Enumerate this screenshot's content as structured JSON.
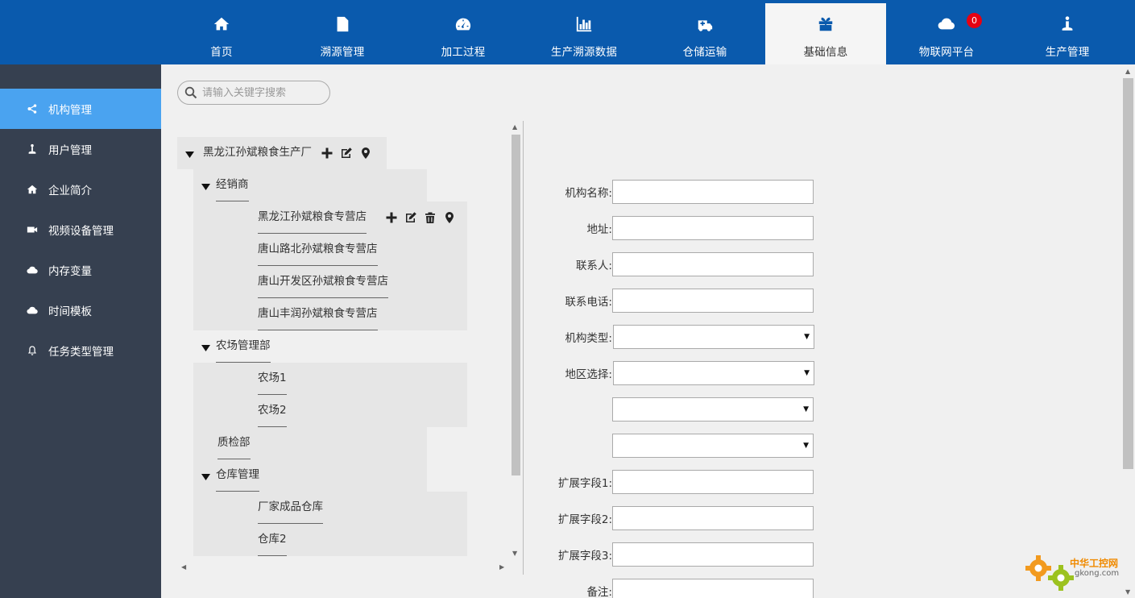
{
  "topnav": {
    "items": [
      {
        "label": "首页",
        "icon": "home-icon",
        "active": false
      },
      {
        "label": "溯源管理",
        "icon": "document-icon",
        "active": false
      },
      {
        "label": "加工过程",
        "icon": "dashboard-icon",
        "active": false
      },
      {
        "label": "生产溯源数据",
        "icon": "bar-chart-icon",
        "active": false
      },
      {
        "label": "仓储运输",
        "icon": "ambulance-icon",
        "active": false
      },
      {
        "label": "基础信息",
        "icon": "gift-icon",
        "active": true
      },
      {
        "label": "物联网平台",
        "icon": "cloud-icon",
        "active": false
      },
      {
        "label": "生产管理",
        "icon": "user-pin-icon",
        "active": false
      }
    ],
    "badge": "0"
  },
  "sidebar": {
    "items": [
      {
        "label": "机构管理",
        "icon": "share-icon",
        "active": true
      },
      {
        "label": "用户管理",
        "icon": "joystick-icon",
        "active": false
      },
      {
        "label": "企业简介",
        "icon": "home-icon",
        "active": false
      },
      {
        "label": "视频设备管理",
        "icon": "video-camera-icon",
        "active": false
      },
      {
        "label": "内存变量",
        "icon": "cloud-icon",
        "active": false
      },
      {
        "label": "时间模板",
        "icon": "cloud-icon",
        "active": false
      },
      {
        "label": "任务类型管理",
        "icon": "bell-icon",
        "active": false
      }
    ]
  },
  "search": {
    "placeholder": "请输入关键字搜索"
  },
  "tree": {
    "root": "黑龙江孙斌粮食生产厂",
    "groups": [
      {
        "label": "经销商",
        "children": [
          "黑龙江孙斌粮食专营店",
          "唐山路北孙斌粮食专营店",
          "唐山开发区孙斌粮食专营店",
          "唐山丰润孙斌粮食专营店"
        ]
      },
      {
        "label": "农场管理部",
        "children": [
          "农场1",
          "农场2"
        ]
      },
      {
        "label": "质检部",
        "children": []
      },
      {
        "label": "仓库管理",
        "children": [
          "厂家成品仓库",
          "仓库2"
        ]
      }
    ]
  },
  "form": {
    "org_name": "机构名称:",
    "address": "地址:",
    "contact": "联系人:",
    "phone": "联系电话:",
    "org_type": "机构类型:",
    "region": "地区选择:",
    "ext1": "扩展字段1:",
    "ext2": "扩展字段2:",
    "ext3": "扩展字段3:",
    "remark": "备注:"
  },
  "watermark": {
    "title": "中华工控网",
    "url": "gkong.com"
  },
  "colors": {
    "nav_bg": "#0a5aad",
    "sidebar_bg": "#364050",
    "sidebar_active": "#4aa3f0",
    "badge": "#e60012"
  }
}
